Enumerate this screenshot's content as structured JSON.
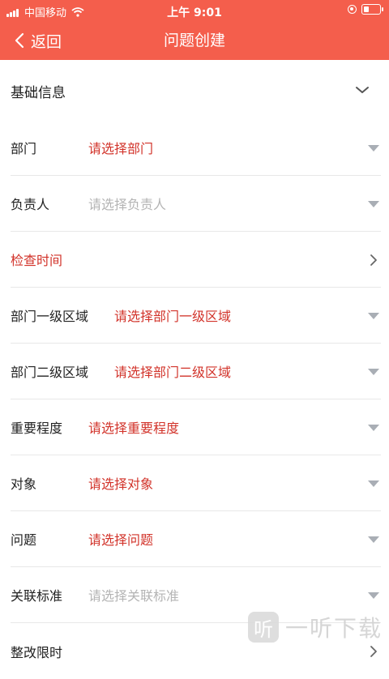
{
  "status_bar": {
    "carrier": "中国移动",
    "time": "上午 9:01"
  },
  "nav": {
    "back_label": "返回",
    "title": "问题创建"
  },
  "section": {
    "title": "基础信息"
  },
  "rows": [
    {
      "label": "部门",
      "value": "请选择部门",
      "label_red": false,
      "value_style": "red",
      "indicator": "dropdown"
    },
    {
      "label": "负责人",
      "value": "请选择负责人",
      "label_red": false,
      "value_style": "gray",
      "indicator": "dropdown"
    },
    {
      "label": "检查时间",
      "value": "",
      "label_red": true,
      "value_style": "none",
      "indicator": "chevron"
    },
    {
      "label": "部门一级区域",
      "value": "请选择部门一级区域",
      "label_red": false,
      "value_style": "red",
      "indicator": "dropdown"
    },
    {
      "label": "部门二级区域",
      "value": "请选择部门二级区域",
      "label_red": false,
      "value_style": "red",
      "indicator": "dropdown"
    },
    {
      "label": "重要程度",
      "value": "请选择重要程度",
      "label_red": false,
      "value_style": "red",
      "indicator": "dropdown"
    },
    {
      "label": "对象",
      "value": "请选择对象",
      "label_red": false,
      "value_style": "red",
      "indicator": "dropdown"
    },
    {
      "label": "问题",
      "value": "请选择问题",
      "label_red": false,
      "value_style": "red",
      "indicator": "dropdown"
    },
    {
      "label": "关联标准",
      "value": "请选择关联标准",
      "label_red": false,
      "value_style": "gray",
      "indicator": "dropdown"
    },
    {
      "label": "整改限时",
      "value": "",
      "label_red": false,
      "value_style": "none",
      "indicator": "chevron"
    }
  ],
  "watermark": {
    "logo_char": "听",
    "text": "一听下载"
  },
  "colors": {
    "header_bg": "#f45e4c",
    "required_red": "#d2332a",
    "placeholder_gray": "#b4b4b4"
  }
}
